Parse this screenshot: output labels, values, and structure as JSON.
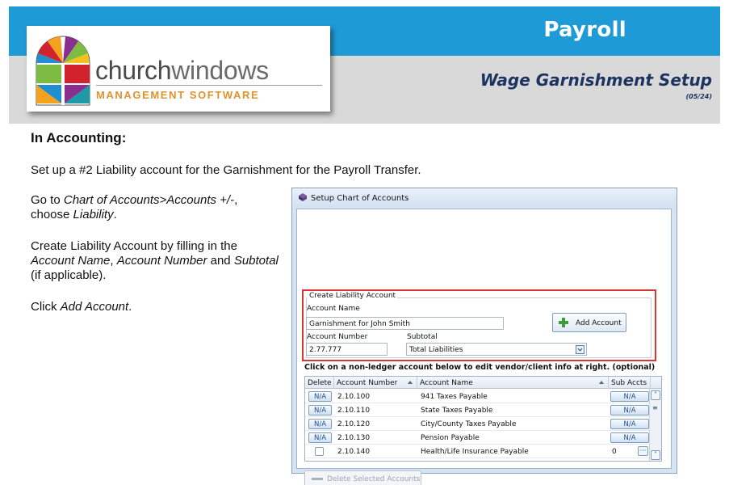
{
  "header": {
    "section": "Payroll",
    "title": "Wage Garnishment Setup",
    "date": "(05/24)",
    "logo": {
      "word1": "church",
      "word2": "windows",
      "tagline": "MANAGEMENT SOFTWARE"
    }
  },
  "body": {
    "heading": "In Accounting:",
    "intro": "Set up a #2 Liability account for the Garnishment for the Payroll Transfer.",
    "step1": {
      "prefix": "Go to ",
      "path": "Chart of Accounts>Accounts +/-",
      "mid": ",",
      "line2": "choose ",
      "choice": "Liability",
      "end": "."
    },
    "step2": {
      "line1": "Create Liability Account by filling in the",
      "field1": "Account Name",
      "sep1": ", ",
      "field2": "Account Number",
      "and": " and ",
      "field3": "Subtotal",
      "line3": "(if applicable)."
    },
    "step3": {
      "prefix": "Click ",
      "button": "Add Account",
      "end": "."
    }
  },
  "dialog": {
    "title": "Setup Chart of Accounts",
    "group_title": "Create Liability Account",
    "account_name_label": "Account Name",
    "account_name_value": "Garnishment for John Smith",
    "account_number_label": "Account Number",
    "account_number_value": "2.77.777",
    "subtotal_label": "Subtotal",
    "subtotal_value": "Total Liabilities",
    "add_button": "Add Account",
    "instruction": "Click on a non-ledger account below to edit vendor/client info at right. (optional)",
    "columns": [
      "Delete",
      "Account Number",
      "Account Name",
      "Sub Accts"
    ],
    "rows": [
      {
        "delete": "N/A",
        "number": "2.10.100",
        "name": "941 Taxes Payable",
        "sub": "N/A"
      },
      {
        "delete": "N/A",
        "number": "2.10.110",
        "name": "State Taxes Payable",
        "sub": "N/A"
      },
      {
        "delete": "N/A",
        "number": "2.10.120",
        "name": "City/County Taxes Payable",
        "sub": "N/A"
      },
      {
        "delete": "N/A",
        "number": "2.10.130",
        "name": "Pension Payable",
        "sub": "N/A"
      },
      {
        "delete": "",
        "number": "2.10.140",
        "name": "Health/Life Insurance Payable",
        "sub": "0"
      }
    ],
    "delete_button": "Delete Selected Accounts"
  }
}
